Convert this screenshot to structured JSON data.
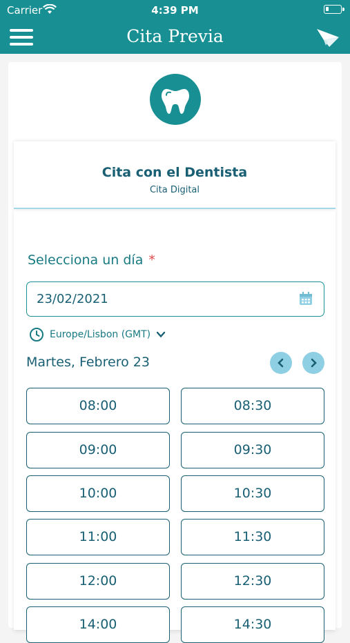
{
  "status_bar": {
    "carrier": "Carrier",
    "time": "4:39 PM"
  },
  "navbar": {
    "title": "Cita Previa",
    "menu_icon": "hamburger-menu-icon",
    "send_icon": "paper-plane-icon"
  },
  "service": {
    "logo_icon": "tooth-icon",
    "title": "Cita con el Dentista",
    "subtitle": "Cita Digital"
  },
  "booking": {
    "select_day_label": "Selecciona un día",
    "required_mark": "*",
    "date_value": "23/02/2021",
    "calendar_icon": "calendar-icon",
    "timezone": "Europe/Lisbon (GMT)",
    "day_title": "Martes, Febrero 23",
    "slots": [
      "08:00",
      "08:30",
      "09:00",
      "09:30",
      "10:00",
      "10:30",
      "11:00",
      "11:30",
      "12:00",
      "12:30",
      "14:00",
      "14:30"
    ]
  },
  "colors": {
    "primary": "#178f93",
    "text_dark": "#185f73",
    "accent_light": "#8ecfe3",
    "required": "#e04a4a"
  }
}
